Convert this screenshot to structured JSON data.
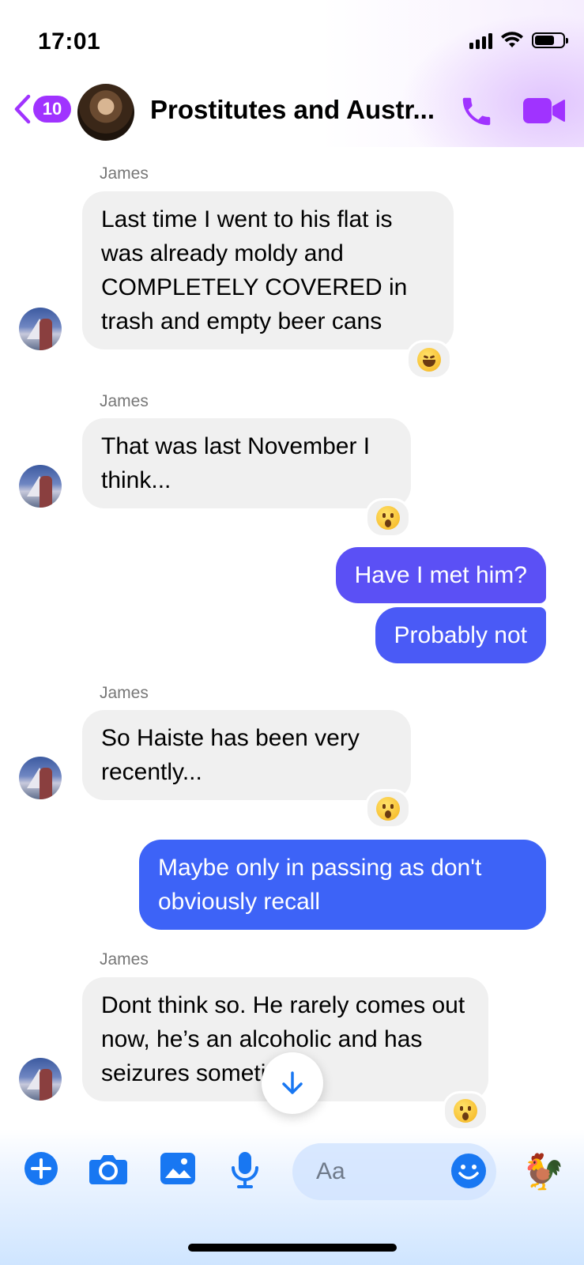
{
  "status_bar": {
    "time": "17:01"
  },
  "header": {
    "back_count": "10",
    "title": "Prostitutes and Austr...",
    "call_icon": "phone-icon",
    "video_icon": "video-camera-icon"
  },
  "messages": [
    {
      "sender": "James",
      "direction": "incoming",
      "text": "Last time I went to his flat is was already moldy and COMPLETELY COVERED in trash and empty beer cans",
      "reaction": "laughing-emoji"
    },
    {
      "sender": "James",
      "direction": "incoming",
      "text": "That was last November I think...",
      "reaction": "surprised-emoji"
    },
    {
      "direction": "outgoing",
      "text": "Have I met him?"
    },
    {
      "direction": "outgoing",
      "text": "Probably not"
    },
    {
      "sender": "James",
      "direction": "incoming",
      "text": "So Haiste has been very recently...",
      "reaction": "surprised-emoji"
    },
    {
      "direction": "outgoing",
      "text": "Maybe only in passing as don't obviously recall"
    },
    {
      "sender": "James",
      "direction": "incoming",
      "text": "Dont think so. He rarely comes out now, he’s an alcoholic and has seizures sometimes",
      "reaction": "surprised-emoji"
    }
  ],
  "composer": {
    "placeholder": "Aa",
    "tools": [
      "plus-icon",
      "camera-icon",
      "image-icon",
      "microphone-icon"
    ],
    "emoji_icon": "smiley-icon",
    "quick_reaction": "🐓"
  },
  "colors": {
    "accent_purple": "#a033ff",
    "outgoing_1": "#5b50f5",
    "outgoing_2": "#3d63f7",
    "incoming_bg": "#f0f0f0",
    "composer_blue": "#1877f2"
  }
}
